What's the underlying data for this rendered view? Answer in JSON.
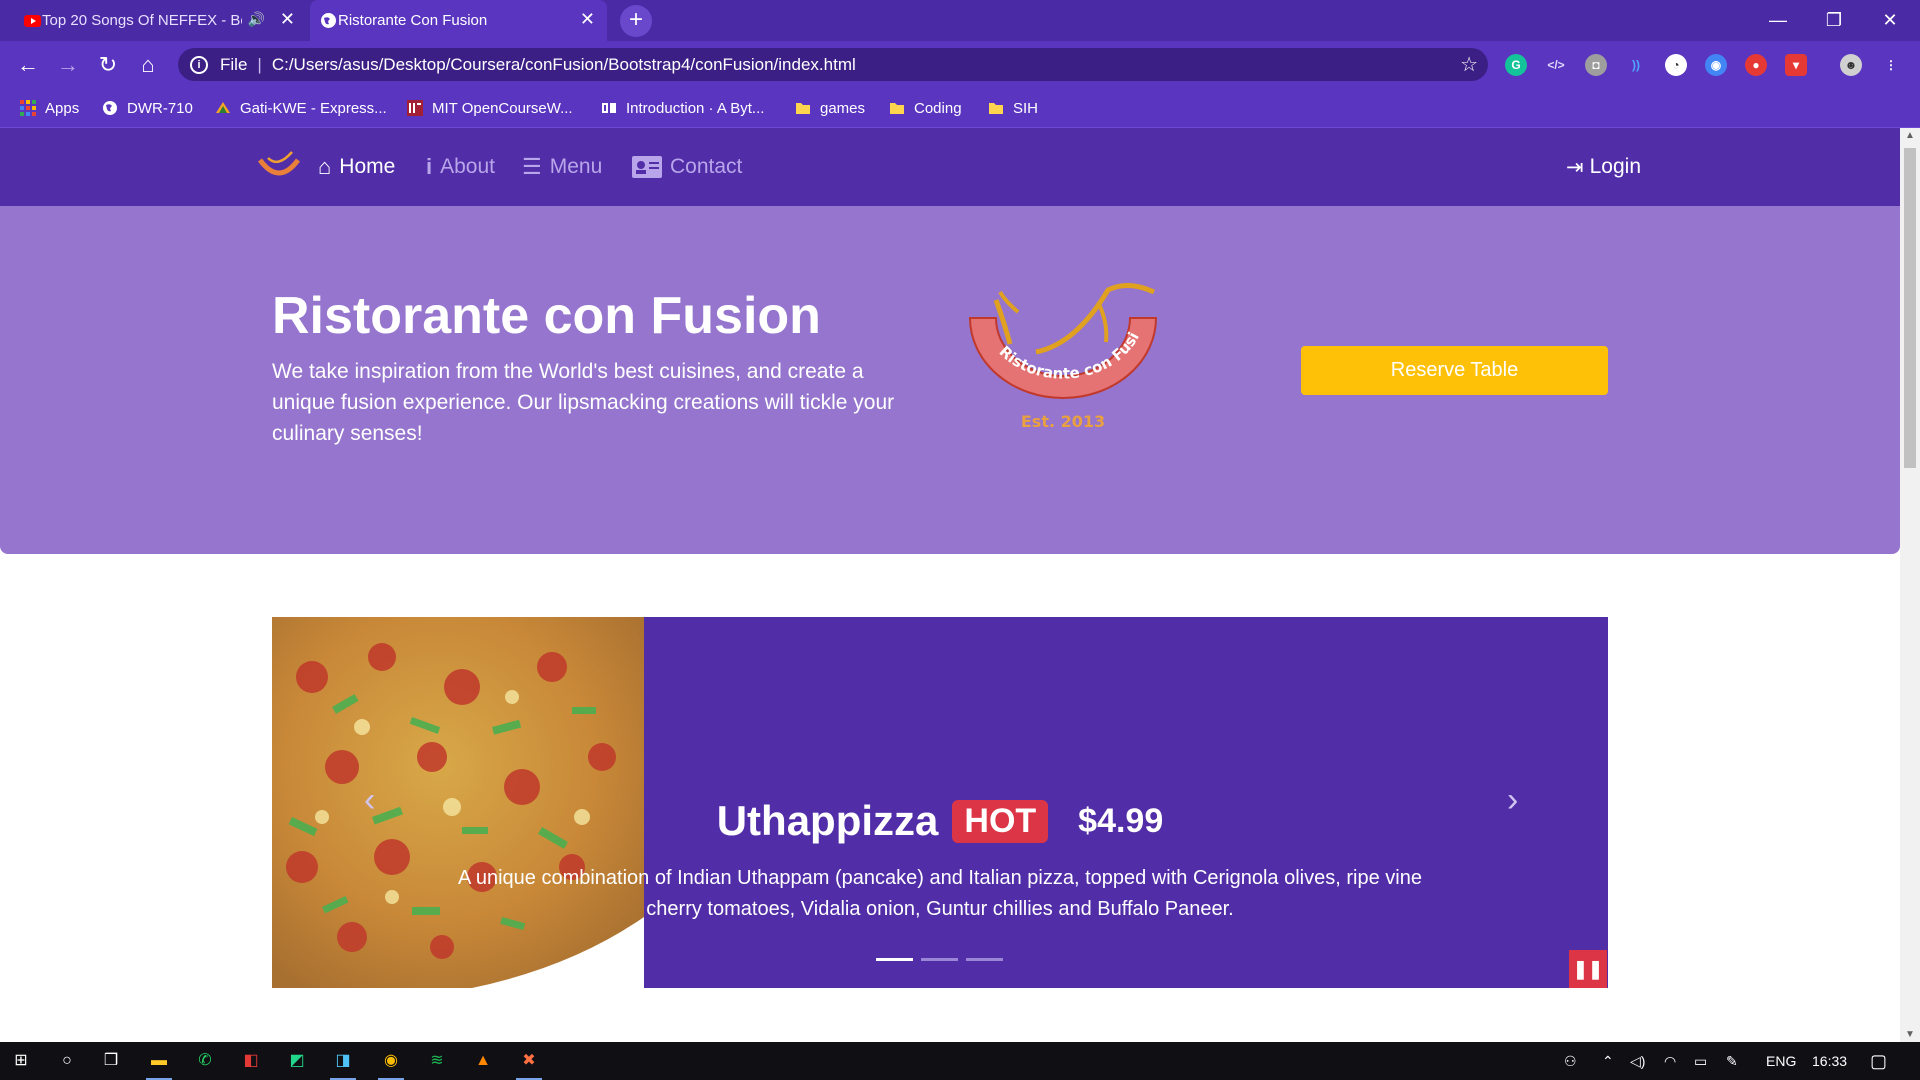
{
  "browser": {
    "tabs": [
      {
        "title": "Top 20 Songs Of NEFFEX - Bo",
        "active": false
      },
      {
        "title": "Ristorante Con Fusion",
        "active": true
      }
    ],
    "url_scheme": "File",
    "url": "C:/Users/asus/Desktop/Coursera/conFusion/Bootstrap4/conFusion/index.html",
    "bookmarks": [
      {
        "label": "Apps",
        "icon": "apps-grid-icon"
      },
      {
        "label": "DWR-710",
        "icon": "globe-icon"
      },
      {
        "label": "Gati-KWE - Express...",
        "icon": "gati-icon"
      },
      {
        "label": "MIT OpenCourseW...",
        "icon": "mit-icon"
      },
      {
        "label": "Introduction · A Byt...",
        "icon": "book-icon"
      },
      {
        "label": "games",
        "icon": "folder-icon"
      },
      {
        "label": "Coding",
        "icon": "folder-icon"
      },
      {
        "label": "SIH",
        "icon": "folder-icon"
      }
    ]
  },
  "nav": {
    "items": [
      {
        "label": "Home",
        "icon": "home-icon",
        "active": true
      },
      {
        "label": "About",
        "icon": "info-icon",
        "active": false
      },
      {
        "label": "Menu",
        "icon": "list-icon",
        "active": false
      },
      {
        "label": "Contact",
        "icon": "address-card-icon",
        "active": false
      }
    ],
    "login": "Login"
  },
  "jumbotron": {
    "title": "Ristorante con Fusion",
    "lead": "We take inspiration from the World's best cuisines, and create a unique fusion experience. Our lipsmacking creations will tickle your culinary senses!",
    "logo_text": "Ristorante con Fusion",
    "logo_est": "Est. 2013",
    "reserve_label": "Reserve Table"
  },
  "carousel": {
    "dish": "Uthappizza",
    "badge": "HOT",
    "price": "$4.99",
    "description": "A unique combination of Indian Uthappam (pancake) and Italian pizza, topped with Cerignola olives, ripe vine cherry tomatoes, Vidalia onion, Guntur chillies and Buffalo Paneer.",
    "slide_count": 3,
    "active_slide": 1
  },
  "taskbar": {
    "lang": "ENG",
    "time": "16:33"
  },
  "colors": {
    "primary": "#512da8",
    "jumbotron": "#9575cd",
    "warning": "#ffc107",
    "danger": "#dc3545"
  }
}
